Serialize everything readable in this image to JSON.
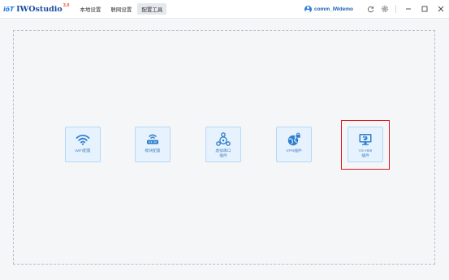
{
  "app": {
    "brand_mark": "iōT",
    "name": "IWOstudio",
    "version": "3.0"
  },
  "menu": [
    {
      "label": "本地设置",
      "active": false
    },
    {
      "label": "联网设置",
      "active": false
    },
    {
      "label": "配置工具",
      "active": true
    }
  ],
  "user": {
    "name": "comm_IWdemo"
  },
  "toolbar_icons": [
    "refresh-icon",
    "settings-icon"
  ],
  "window_controls": [
    "minimize-icon",
    "maximize-icon",
    "close-icon"
  ],
  "tools": [
    {
      "label": "WiFi配置",
      "icon": "wifi-icon"
    },
    {
      "label": "模块配置",
      "icon": "router-icon"
    },
    {
      "label": "虚拟串口\n插件",
      "icon": "network-triangle-icon"
    },
    {
      "label": "VPN插件",
      "icon": "vpn-shield-icon"
    },
    {
      "label": "VS-HMI\n插件",
      "icon": "hmi-monitor-icon"
    }
  ],
  "colors": {
    "accent": "#2d7fdb",
    "card_bg": "#e6f2fd",
    "card_border": "#b6d8f5",
    "highlight": "#e0141e",
    "icon": "#2f7fd0"
  }
}
